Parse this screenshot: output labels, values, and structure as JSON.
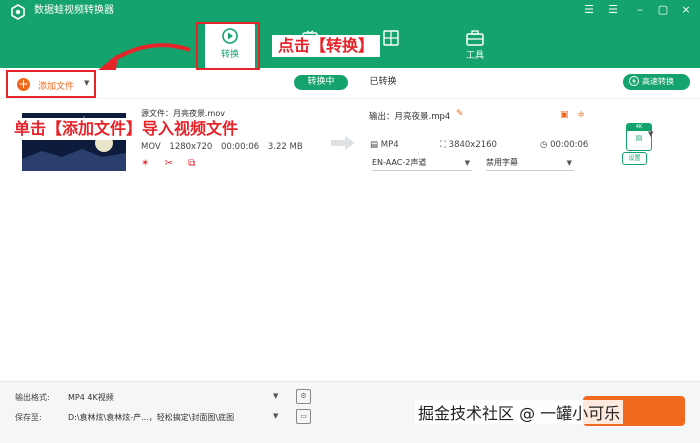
{
  "app": {
    "title": "数据蛙视频转换器"
  },
  "window": {
    "menu_icon": "☰",
    "minimize_icon": "–",
    "maximize_icon": "▢",
    "close_icon": "×"
  },
  "tabs": {
    "convert": "转换",
    "tools": "工具"
  },
  "annotations": {
    "click_convert": "点击【转换】",
    "add_file": "单击【添加文件】导入视频文件"
  },
  "toolbar": {
    "add_file": "添加文件",
    "converting": "转换中",
    "converted": "已转换",
    "fast_convert": "高速转换"
  },
  "source": {
    "name": "源文件：月亮夜景.mov",
    "format": "MOV",
    "resolution": "1280x720",
    "duration": "00:00:06",
    "size": "3.22 MB"
  },
  "output": {
    "name": "输出：月亮夜景.mp4",
    "format": "MP4",
    "resolution": "3840x2160",
    "duration": "00:00:06",
    "audio": "EN-AAC-2声道",
    "subtitle": "禁用字幕",
    "badge": "4K",
    "settings": "设置"
  },
  "bottom": {
    "format_label": "输出格式:",
    "format_value": "MP4 4K视频",
    "save_label": "保存至:",
    "save_value": "D:\\袁林炫\\袁林炫-产...，轻松搞定\\封面图\\底图"
  },
  "watermark": "掘金技术社区 @ 一罐小可乐",
  "colors": {
    "brand": "#14a36d",
    "accent": "#f06a1d",
    "annotation": "#e8242b"
  }
}
